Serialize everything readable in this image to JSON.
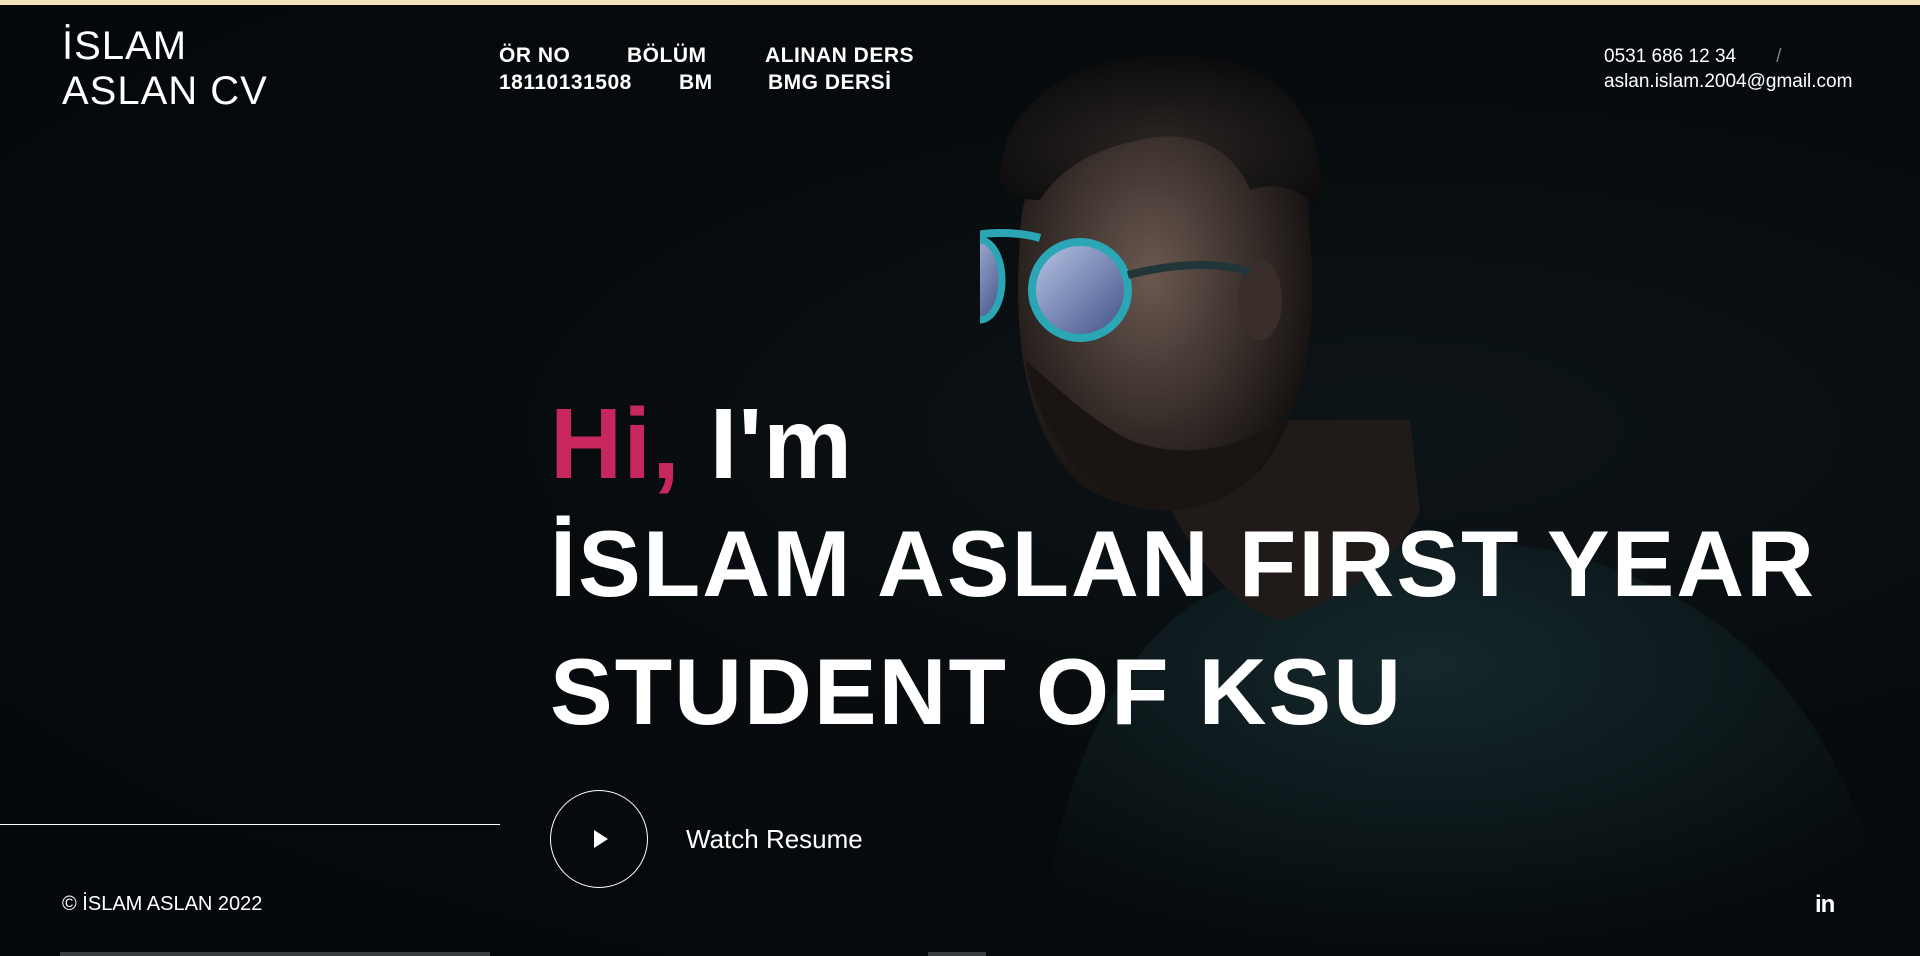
{
  "brand": {
    "line1": "İSLAM",
    "line2": "ASLAN CV"
  },
  "nav": {
    "col1_header": "ÖR NO",
    "col1_value": "18110131508",
    "col2_header": "BÖLÜM",
    "col2_value": "BM",
    "col3_header": "ALINAN DERS",
    "col3_value": "BMG DERSİ"
  },
  "contact": {
    "phone": "0531 686 12 34",
    "separator": "/",
    "email": "aslan.islam.2004@gmail.com"
  },
  "hero": {
    "greeting_accent": "Hi,",
    "greeting_rest": " I'm",
    "name_line1": "İSLAM ASLAN FIRST YEAR",
    "name_line2": "STUDENT OF KSU",
    "accent_color": "#c7275d"
  },
  "watch": {
    "label": "Watch Resume",
    "icon": "play-icon"
  },
  "footer": {
    "copyright": "© İSLAM ASLAN 2022",
    "social_icon": "linkedin-icon",
    "social_text": "in"
  }
}
